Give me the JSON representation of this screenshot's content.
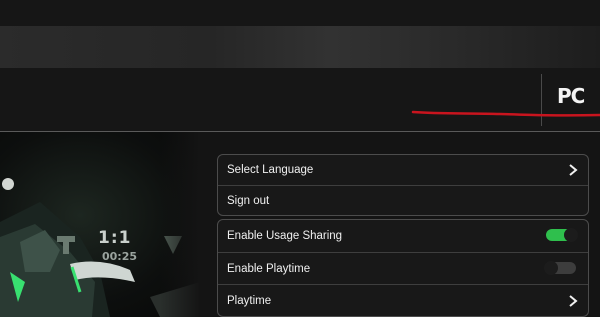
{
  "header": {
    "platform": "PC"
  },
  "hero": {
    "score": "1:1",
    "clock": "00:25"
  },
  "account_panel": {
    "items": [
      {
        "label": "Select Language",
        "control": "chevron-right-icon"
      },
      {
        "label": "Sign out"
      }
    ]
  },
  "settings_panel": {
    "items": [
      {
        "label": "Enable Usage Sharing",
        "control": "toggle",
        "enabled": true
      },
      {
        "label": "Enable Playtime",
        "control": "toggle",
        "enabled": false
      },
      {
        "label": "Playtime",
        "control": "chevron-right-icon"
      }
    ]
  },
  "colors": {
    "toggle_on": "#2fbf4d",
    "toggle_off": "#3d3d3d",
    "annotation_red": "#c8141e",
    "background": "#141414"
  }
}
